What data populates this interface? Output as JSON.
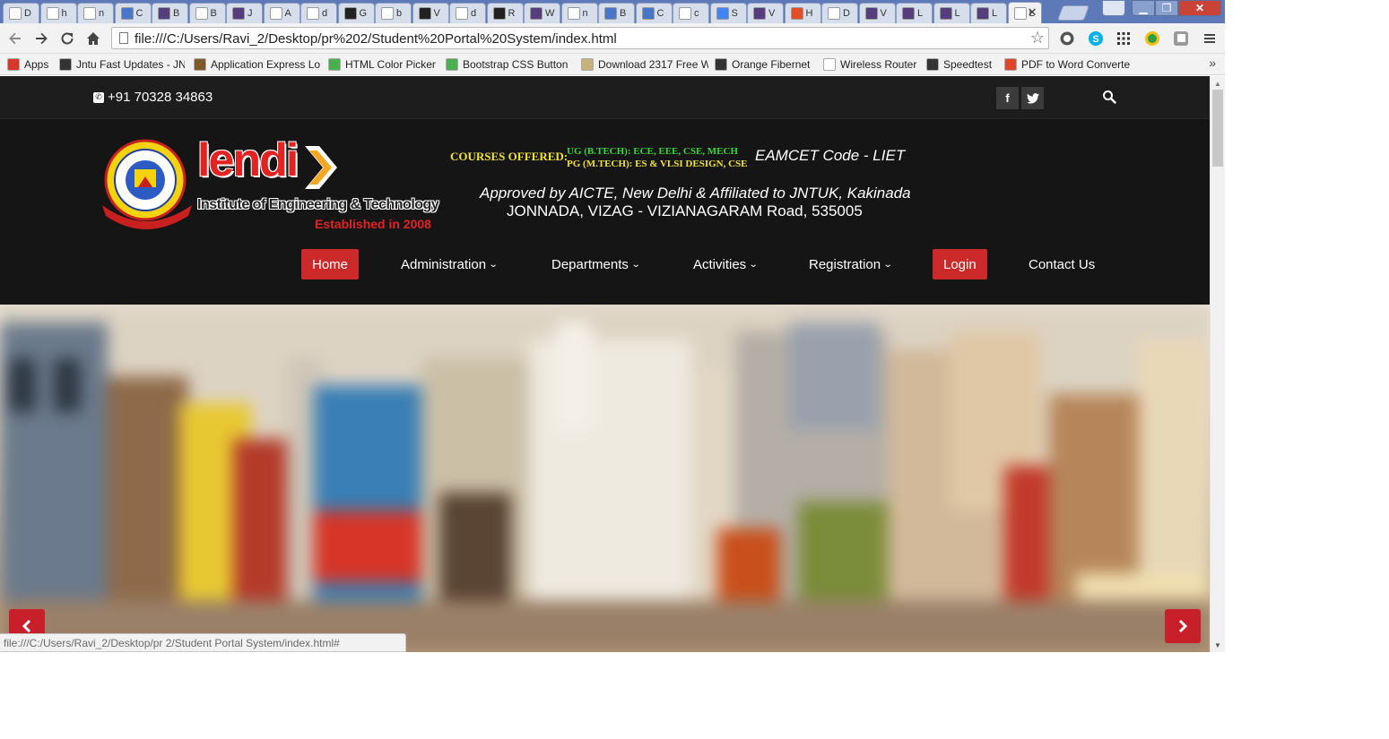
{
  "browser": {
    "tabs": [
      {
        "short": "D",
        "icon": "document-icon",
        "color": "#ffffff"
      },
      {
        "short": "h",
        "icon": "orange-fibernet-icon",
        "color": "#ffffff"
      },
      {
        "short": "n",
        "icon": "google-icon",
        "color": "#ffffff"
      },
      {
        "short": "C",
        "icon": "code-icon",
        "color": "#4a76c7"
      },
      {
        "short": "B",
        "icon": "bootstrap-icon",
        "color": "#563d7c"
      },
      {
        "short": "B",
        "icon": "document-icon",
        "color": "#ffffff"
      },
      {
        "short": "J",
        "icon": "bootstrap-icon",
        "color": "#563d7c"
      },
      {
        "short": "A",
        "icon": "document-icon",
        "color": "#ffffff"
      },
      {
        "short": "d",
        "icon": "google-icon",
        "color": "#ffffff"
      },
      {
        "short": "G",
        "icon": "github-icon",
        "color": "#222222"
      },
      {
        "short": "b",
        "icon": "document-icon",
        "color": "#ffffff"
      },
      {
        "short": "V",
        "icon": "github-icon",
        "color": "#222222"
      },
      {
        "short": "d",
        "icon": "google-icon",
        "color": "#ffffff"
      },
      {
        "short": "R",
        "icon": "github-icon",
        "color": "#222222"
      },
      {
        "short": "W",
        "icon": "bootstrap-icon",
        "color": "#563d7c"
      },
      {
        "short": "n",
        "icon": "document-icon",
        "color": "#ffffff"
      },
      {
        "short": "B",
        "icon": "code-icon",
        "color": "#4a76c7"
      },
      {
        "short": "C",
        "icon": "code-icon",
        "color": "#4a76c7"
      },
      {
        "short": "c",
        "icon": "gmail-icon",
        "color": "#ffffff"
      },
      {
        "short": "S",
        "icon": "docs-icon",
        "color": "#4285f4"
      },
      {
        "short": "V",
        "icon": "bootstrap-icon",
        "color": "#563d7c"
      },
      {
        "short": "H",
        "icon": "joomla-icon",
        "color": "#e44d26"
      },
      {
        "short": "D",
        "icon": "download-icon",
        "color": "#ffffff"
      },
      {
        "short": "V",
        "icon": "bootstrap-icon",
        "color": "#563d7c"
      },
      {
        "short": "L",
        "icon": "bootstrap-icon",
        "color": "#563d7c"
      },
      {
        "short": "L",
        "icon": "bootstrap-icon",
        "color": "#563d7c"
      },
      {
        "short": "L",
        "icon": "bootstrap-icon",
        "color": "#563d7c"
      },
      {
        "short": "L",
        "icon": "document-icon",
        "color": "#ffffff",
        "active": true
      }
    ],
    "url": "file:///C:/Users/Ravi_2/Desktop/pr%202/Student%20Portal%20System/index.html",
    "window_controls": {
      "min": "▁",
      "max": "❐",
      "close": "✕"
    },
    "bookmarks": [
      {
        "label": "Apps",
        "icon": "apps-grid-icon",
        "color": "#d9372b"
      },
      {
        "label": "Jntu Fast Updates - JN",
        "icon": "graduation-cap-icon",
        "color": "#333333"
      },
      {
        "label": "Application Express Lo",
        "icon": "chart-icon",
        "color": "#7d5a2a"
      },
      {
        "label": "HTML Color Picker",
        "icon": "w3-icon",
        "color": "#4caf50"
      },
      {
        "label": "Bootstrap CSS Button",
        "icon": "w3-icon",
        "color": "#4caf50"
      },
      {
        "label": "Download 2317 Free W",
        "icon": "folder-icon",
        "color": "#c9b27a"
      },
      {
        "label": "Orange Fibernet",
        "icon": "orange-fibernet-icon",
        "color": "#333333"
      },
      {
        "label": "Wireless Router",
        "icon": "document-icon",
        "color": "#ffffff"
      },
      {
        "label": "Speedtest",
        "icon": "speedometer-icon",
        "color": "#333333"
      },
      {
        "label": "PDF to Word Converte",
        "icon": "pdf-icon",
        "color": "#e0452b"
      }
    ],
    "status_url": "file:///C:/Users/Ravi_2/Desktop/pr 2/Student Portal System/index.html#"
  },
  "site": {
    "phone": "+91 70328 34863",
    "social": {
      "facebook": "f",
      "twitter": "t"
    },
    "brand": {
      "name": "lendi",
      "subtitle": "Institute of Engineering & Technology",
      "established": "Established in 2008"
    },
    "courses_label": "COURSES OFFERED:",
    "course_ug": "UG (B.TECH): ECE, EEE, CSE, MECH",
    "course_pg": "PG (M.TECH): ES & VLSI DESIGN, CSE",
    "eamcet": "EAMCET Code - LIET",
    "approved": "Approved by AICTE, New Delhi & Affiliated to JNTUK, Kakinada",
    "address": "JONNADA, VIZAG - VIZIANAGARAM Road, 535005",
    "nav": [
      {
        "label": "Home",
        "highlight": true,
        "dropdown": false
      },
      {
        "label": "Administration",
        "highlight": false,
        "dropdown": true
      },
      {
        "label": "Departments",
        "highlight": false,
        "dropdown": true
      },
      {
        "label": "Activities",
        "highlight": false,
        "dropdown": true
      },
      {
        "label": "Registration",
        "highlight": false,
        "dropdown": true
      },
      {
        "label": "Login",
        "highlight": true,
        "dropdown": false
      },
      {
        "label": "Contact Us",
        "highlight": false,
        "dropdown": false
      }
    ],
    "carousel": {
      "prev": "‹",
      "next": "›"
    }
  },
  "colors": {
    "accent_red": "#cc2a2a",
    "header_bg": "#151515",
    "course_yellow": "#f0e232",
    "course_green": "#34d534"
  }
}
